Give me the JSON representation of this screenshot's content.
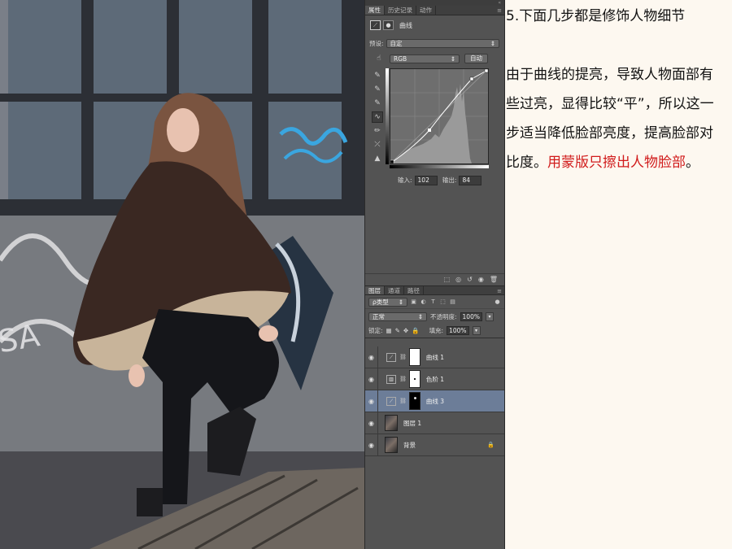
{
  "panel": {
    "tabs": [
      "属性",
      "历史记录",
      "动作"
    ],
    "properties_title": "曲线",
    "preset_label": "预设:",
    "preset_value": "自定",
    "channel_value": "RGB",
    "auto_button": "自动",
    "input_label": "输入:",
    "input_value": "102",
    "output_label": "输出:",
    "output_value": "84"
  },
  "layers_panel": {
    "tabs": [
      "图层",
      "通道",
      "路径"
    ],
    "filter_value": "ρ类型",
    "blend_mode": "正常",
    "opacity_label": "不透明度:",
    "opacity_value": "100%",
    "lock_label": "锁定:",
    "fill_label": "填充:",
    "fill_value": "100%",
    "layers": [
      {
        "name": "曲线 1",
        "kind": "curves",
        "selected": false
      },
      {
        "name": "色阶 1",
        "kind": "levels",
        "selected": false
      },
      {
        "name": "曲线 3",
        "kind": "curves",
        "selected": true
      },
      {
        "name": "图层 1",
        "kind": "pixel",
        "selected": false
      },
      {
        "name": "背景",
        "kind": "background",
        "selected": false
      }
    ]
  },
  "article": {
    "heading": "5.下面几步都是修饰人物细节",
    "body": "由于曲线的提亮，导致人物面部有些过亮，显得比较“平”，所以这一步适当降低脸部亮度，提高脸部对比度。",
    "highlight": "用蒙版只擦出人物脸部",
    "end": "。"
  },
  "colors": {
    "panel_bg": "#535353",
    "selected_layer": "#6c7d98",
    "highlight_text": "#d11b1b",
    "page_bg": "#fdf8f0"
  }
}
